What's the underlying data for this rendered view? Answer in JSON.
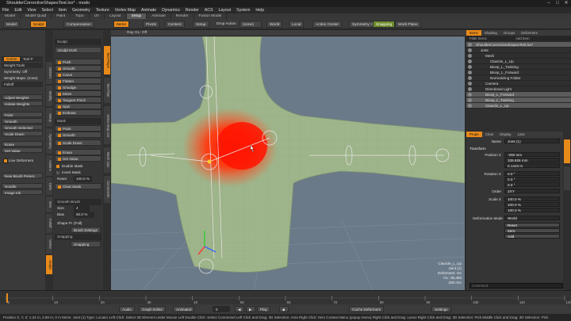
{
  "app": {
    "title": "ShoulderCorrectiveShapesTest.lxo* - modo",
    "window_controls": [
      "–",
      "□",
      "✕"
    ]
  },
  "menu": [
    "File",
    "Edit",
    "View",
    "Select",
    "Item",
    "Geometry",
    "Texture",
    "Vertex Map",
    "Animate",
    "Dynamics",
    "Render",
    "ACS",
    "Layout",
    "System",
    "Help"
  ],
  "layout_tabs": {
    "items": [
      "Model",
      "Model Quad",
      "Paint",
      "Topo",
      "UV",
      "Layout",
      "Setup",
      "Animate",
      "Render",
      "Fusion Model"
    ],
    "active_index": 6
  },
  "toolbar": {
    "model": "Model",
    "sculpt": "Sculpt",
    "compensation": "Compensation",
    "items": "Items",
    "pivots": "Pivots",
    "centers": "Centers",
    "setup": "Setup",
    "drop_action": "Drop Action",
    "drop_value": "(none)",
    "world": "World",
    "local": "Local",
    "action_center": "Action Center",
    "symmetry": "Symmetry: Off",
    "snapping": "Snapping",
    "work_plane": "Work Plane"
  },
  "left_panel": {
    "tabs": [
      "Comm",
      "Tool P"
    ],
    "weight_tools": "Weight Tools",
    "symmetry": "Symmetry: Off",
    "weight_maps": "Weight Maps: (none)",
    "falloff": "Falloff",
    "adjust_weights": "Adjust Weights",
    "isolate_weights": "Isolate Weights",
    "paint": "Paint",
    "smooth": "Smooth",
    "smooth_selected": "Smooth Selected",
    "scale_down": "Scale Down",
    "erase": "Erase",
    "set_value": "Set Value",
    "live_deformers": "Live Deformers",
    "new_brush_preset": "New Brush Preset...",
    "noodle": "Noodle",
    "image_ink": "Image Ink"
  },
  "vertical_tabs_left": [
    "Deform",
    "Modify",
    "Setup",
    "Symmetry",
    "Actions",
    "Defo",
    "Item",
    "Falloff",
    "Vertex",
    "Sculpt"
  ],
  "vertical_tabs_mid": [
    "Tool Props",
    "Tool Pipe",
    "Vertex Map List",
    "Mesh Ops",
    "Commands"
  ],
  "tool_panel": {
    "title": "Sculpt",
    "hud": "Sculpt HUD",
    "tools": [
      "Push",
      "Smooth",
      "Carve",
      "Flatten",
      "Smudge",
      "Move",
      "Tangent Pinch",
      "Spin",
      "Emboss"
    ],
    "mask": "Mask",
    "paint": "Paint",
    "smooth": "Smooth",
    "scale_down": "Scale Down",
    "erase": "Erase",
    "set_value": "Set Value",
    "enable_mask": "Enable Mask",
    "invert_mask": "Invert Mask",
    "reset_label": "Reset",
    "reset_value": "100.0 %",
    "clear_mask": "Clear Mask",
    "smooth_brush": "Smooth Brush",
    "size_label": "Size",
    "size_value": "4",
    "bias_label": "Bias",
    "bias_value": "50.0 %",
    "shape_pr": "Shape Pr",
    "shape_pr_value": "(Full)",
    "brush_settings": "Brush Settings",
    "snapping": "Snapping",
    "snapping_btn": "Snapping"
  },
  "viewport": {
    "perspective": "Perspective",
    "shaded": "Shaded",
    "ray_gl": "Ray GL: Off",
    "overlay": [
      "Clavicle_L_Up",
      "Joint (1)",
      "Deformers: On",
      "GL: 35,456",
      "200 mm"
    ]
  },
  "outliner": {
    "tabs": [
      "Items",
      "Shading",
      "Groups",
      "Deformers"
    ],
    "header_left": "Filter Items",
    "header_right": "Add Item",
    "rows": [
      {
        "name": "ShoulderCorrectiveShapesTest.lxo*",
        "indent": 0,
        "selected": true
      },
      {
        "name": "Joint",
        "indent": 1,
        "selected": false
      },
      {
        "name": "Mesh",
        "indent": 2,
        "selected": false
      },
      {
        "name": "Clavicle_L_Up",
        "indent": 3,
        "selected": false
      },
      {
        "name": "Bicep_L_Twisting",
        "indent": 3,
        "selected": false
      },
      {
        "name": "Bicep_L_Forward",
        "indent": 3,
        "selected": false
      },
      {
        "name": "Normalizing Folder",
        "indent": 3,
        "selected": false
      },
      {
        "name": "Camera",
        "indent": 2,
        "selected": false
      },
      {
        "name": "Directional Light",
        "indent": 2,
        "selected": false
      },
      {
        "name": "Bicep_L_Forward",
        "indent": 2,
        "selected": true
      },
      {
        "name": "Bicep_L_Twisting",
        "indent": 2,
        "selected": true
      },
      {
        "name": "Clavicle_L_Up",
        "indent": 2,
        "selected": true
      }
    ]
  },
  "properties": {
    "tabs": [
      "Prope",
      "Chan",
      "Display",
      "Lists"
    ],
    "name_label": "Name",
    "name_value": "Joint (1)",
    "section": "Transform",
    "position_label": "Position X",
    "position": [
      "-260 mm",
      "339.626 mm",
      "0.1423 m"
    ],
    "rotation_label": "Rotation X",
    "rotation": [
      "0.0 °",
      "0.0 °",
      "0.0 °"
    ],
    "order_label": "Order",
    "order_value": "ZXY",
    "scale_label": "Scale X",
    "scale": [
      "100.0 %",
      "100.0 %",
      "100.0 %"
    ],
    "deformation_label": "Deformation Mode",
    "deformation_value": "World",
    "reset": "Reset",
    "zero": "Zero",
    "add": "Add",
    "command_placeholder": "Command"
  },
  "timeline": {
    "ticks": [
      "0",
      "10",
      "20",
      "30",
      "40",
      "50",
      "60",
      "70",
      "80",
      "90",
      "100",
      "110",
      "120"
    ]
  },
  "transport": {
    "audio": "Audio",
    "graph_editor": "Graph Editor",
    "animated": "Animated",
    "frame": "0",
    "play": "Play",
    "cache_deformers": "Cache Deformers",
    "settings": "Settings"
  },
  "status": "Position X, Y, Z: 1.24 m, 2.89 m, 0 m  Items: Joint (1)  Type: Locator    Left Click: Select 3D Element under Mouse  Left Double Click: Select Connected  Left Click and Drag: 3D Selection: Area  Right Click: Item Context Menu (popup menu)  Right Click and Drag: Lasso  Right Click and Drag: 3D Selection: Pick  Middle Click and Drag: 3D Selection: Pick"
}
